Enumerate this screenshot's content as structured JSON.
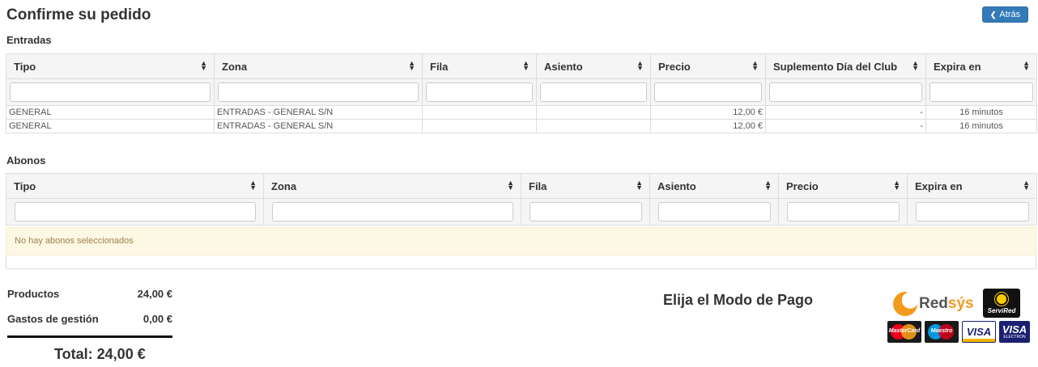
{
  "page": {
    "title": "Confirme su pedido",
    "back_label": "Atrás"
  },
  "entradas": {
    "title": "Entradas",
    "columns": [
      "Tipo",
      "Zona",
      "Fila",
      "Asiento",
      "Precio",
      "Suplemento Día del Club",
      "Expira en"
    ],
    "rows": [
      [
        "GENERAL",
        "ENTRADAS - GENERAL S/N",
        "",
        "",
        "12,00 €",
        "-",
        "16 minutos"
      ],
      [
        "GENERAL",
        "ENTRADAS - GENERAL S/N",
        "",
        "",
        "12,00 €",
        "-",
        "16 minutos"
      ]
    ]
  },
  "abonos": {
    "title": "Abonos",
    "columns": [
      "Tipo",
      "Zona",
      "Fila",
      "Asiento",
      "Precio",
      "Expira en"
    ],
    "empty_message": "No hay abonos seleccionados"
  },
  "summary": {
    "productos_label": "Productos",
    "productos_value": "24,00 €",
    "gastos_label": "Gastos de gestión",
    "gastos_value": "0,00 €",
    "total": "Total: 24,00 €"
  },
  "payment": {
    "title": "Elija el Modo de Pago",
    "redsys_text": "Red",
    "redsys_accent": "sýs",
    "servired_text": "ServiRed",
    "cards": [
      "MasterCard",
      "Maestro",
      "VISA",
      "VISA",
      "ELECTRON"
    ]
  },
  "colors": {
    "primary": "#337ab7",
    "warning_bg": "#fcf8e3",
    "redsys_orange": "#f39a1e",
    "visa_blue": "#1a1f71"
  }
}
